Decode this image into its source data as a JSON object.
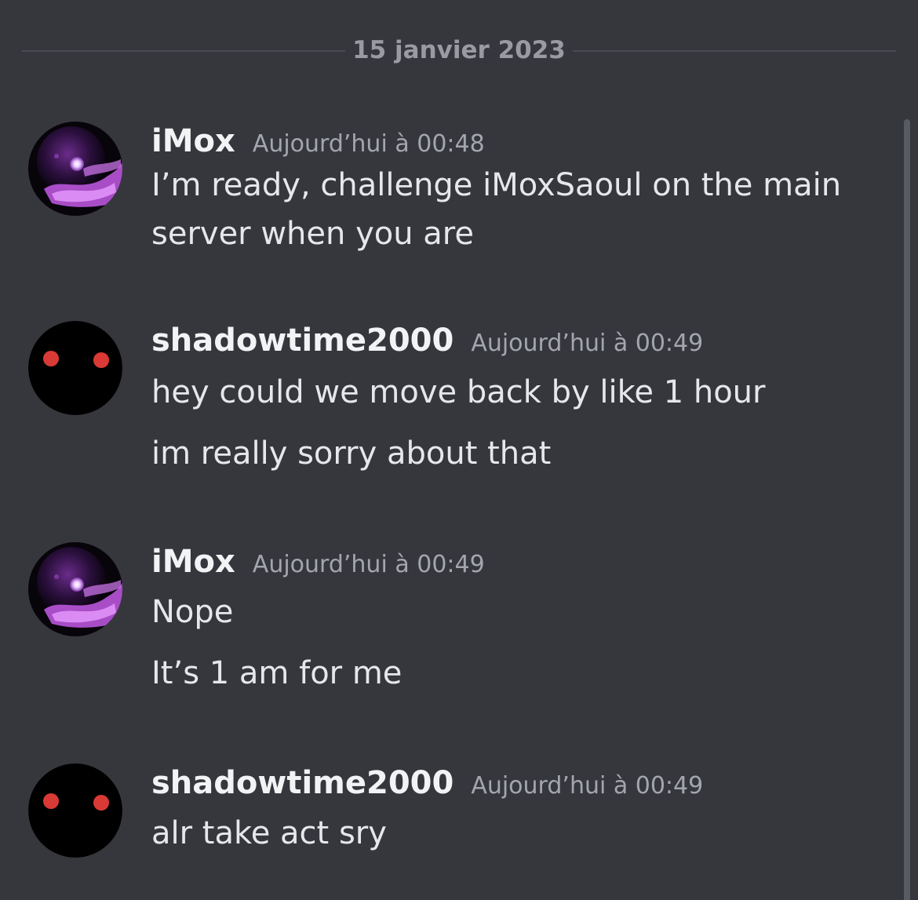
{
  "date_divider": "15 janvier 2023",
  "messages": [
    {
      "author": "iMox",
      "timestamp": "Aujourd’hui à 00:48",
      "avatar_icon": "galaxy-orb-avatar",
      "lines": [
        "I’m ready, challenge iMoxSaoul on the main",
        "server when you are"
      ]
    },
    {
      "author": "shadowtime2000",
      "timestamp": "Aujourd’hui à 00:49",
      "avatar_icon": "red-eyes-avatar",
      "lines": [
        "hey could we move back by like 1 hour",
        "im really sorry about that"
      ]
    },
    {
      "author": "iMox",
      "timestamp": "Aujourd’hui à 00:49",
      "avatar_icon": "galaxy-orb-avatar",
      "lines": [
        "Nope",
        "It’s 1 am for me"
      ]
    },
    {
      "author": "shadowtime2000",
      "timestamp": "Aujourd’hui à 00:49",
      "avatar_icon": "red-eyes-avatar",
      "lines": [
        "alr take act sry"
      ]
    }
  ],
  "colors": {
    "background": "#36373d",
    "username": "#f2f3f5",
    "timestamp": "#a3a6ad",
    "message_text": "#e6e7ea",
    "eye_red": "#d93a35"
  }
}
